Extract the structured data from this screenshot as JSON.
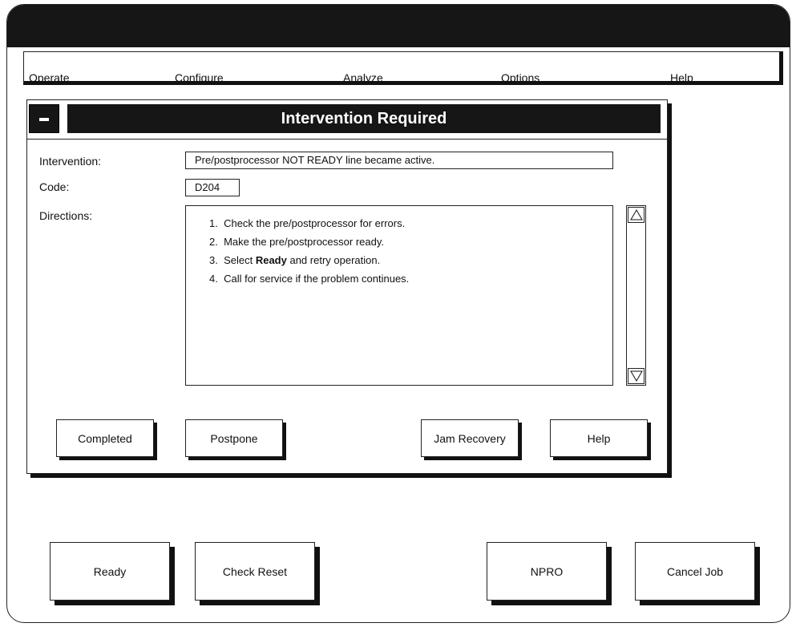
{
  "menu": {
    "items": [
      "Operate",
      "Configure",
      "Analyze",
      "Options",
      "Help"
    ]
  },
  "dialog": {
    "title": "Intervention Required",
    "intervention_label": "Intervention:",
    "intervention_value": "Pre/postprocessor NOT READY line became active.",
    "code_label": "Code:",
    "code_value": "D204",
    "directions_label": "Directions:",
    "directions": [
      {
        "num": "1.",
        "pre": "Check the pre/postprocessor for errors.",
        "bold": "",
        "post": ""
      },
      {
        "num": "2.",
        "pre": "Make the pre/postprocessor ready.",
        "bold": "",
        "post": ""
      },
      {
        "num": "3.",
        "pre": "Select ",
        "bold": "Ready",
        "post": " and retry operation."
      },
      {
        "num": "4.",
        "pre": "Call for service if the problem continues.",
        "bold": "",
        "post": ""
      }
    ],
    "buttons": {
      "completed": "Completed",
      "postpone": "Postpone",
      "jam_recovery": "Jam Recovery",
      "help": "Help"
    }
  },
  "bottom_buttons": {
    "ready": "Ready",
    "check_reset": "Check Reset",
    "npro": "NPRO",
    "cancel_job": "Cancel Job"
  }
}
